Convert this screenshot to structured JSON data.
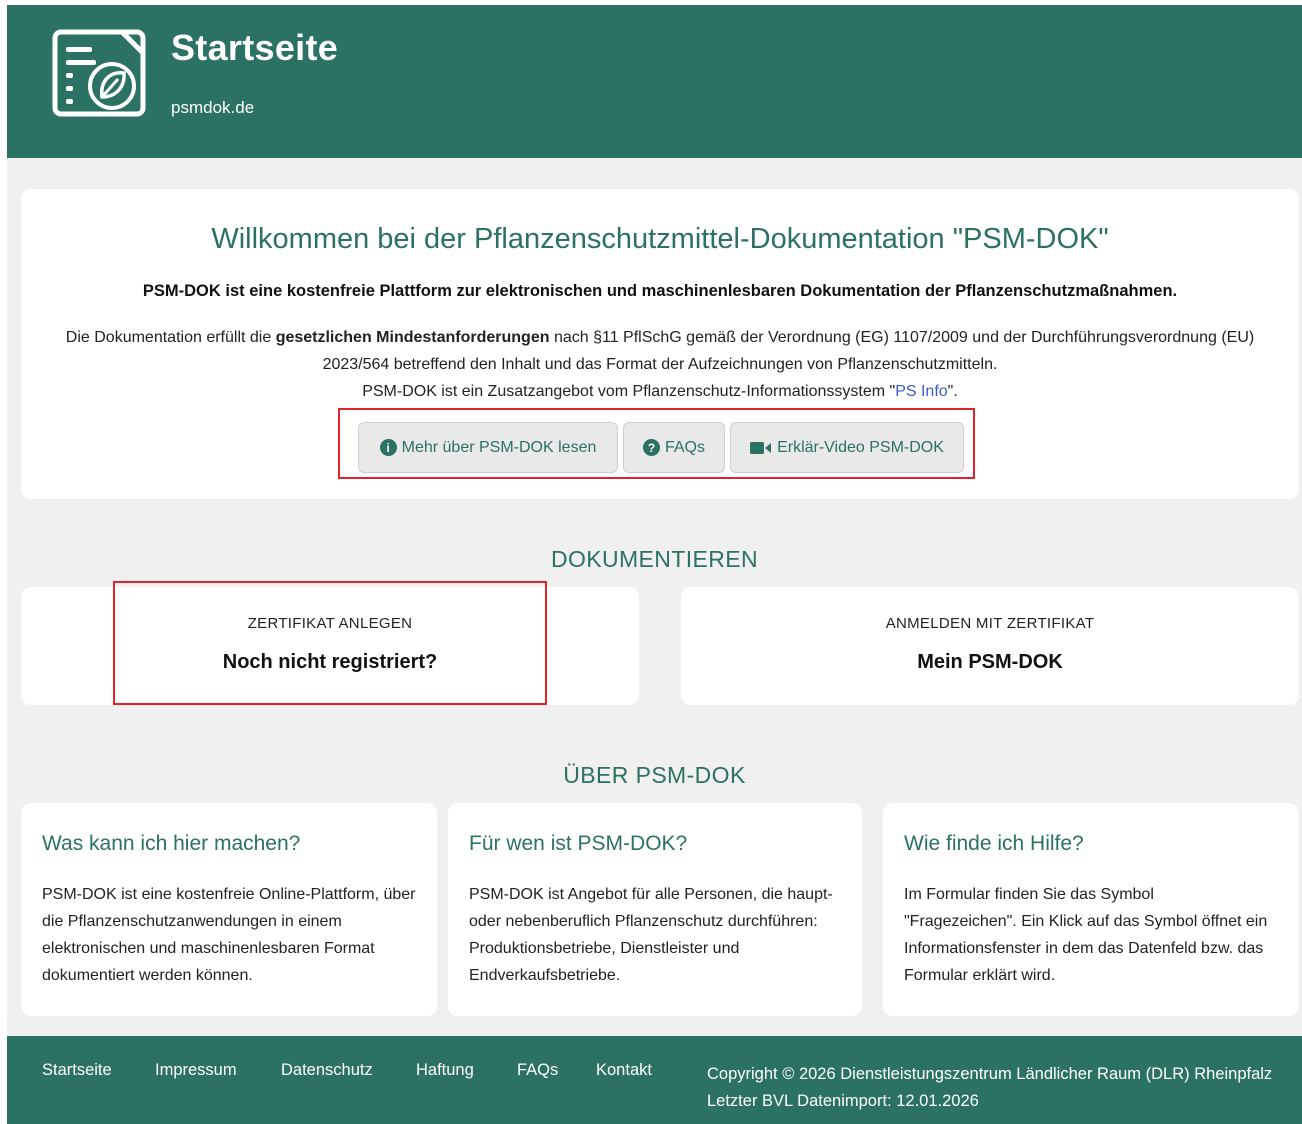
{
  "header": {
    "title": "Startseite",
    "subtitle": "psmdok.de",
    "logo_icon": "document-leaf-icon",
    "bg_color": "#2b7164"
  },
  "welcome": {
    "heading": "Willkommen bei der Pflanzenschutzmittel-Dokumentation \"PSM-DOK\"",
    "lead": "PSM-DOK ist eine kostenfreie Plattform zur elektronischen und maschinenlesbaren Dokumentation der Pflanzenschutzmaßnahmen.",
    "desc_part1": "Die Dokumentation erfüllt die ",
    "desc_bold": "gesetzlichen Mindestanforderungen",
    "desc_part2": " nach §11 PflSchG gemäß der Verordnung (EG) 1107/2009 und der Durchführungsverordnung (EU) 2023/564 betreffend den Inhalt und das Format der Aufzeichnungen von Pflanzenschutzmitteln.",
    "desc_line3_pre": "PSM-DOK ist ein Zusatzangebot vom Pflanzenschutz-Informationssystem \"",
    "desc_link": "PS Info",
    "desc_line3_post": "\".",
    "buttons": {
      "more_label": "Mehr über PSM-DOK lesen",
      "more_icon": "info-circle-icon",
      "faq_label": "FAQs",
      "faq_icon": "question-circle-icon",
      "video_label": "Erklär-Video PSM-DOK",
      "video_icon": "video-camera-icon"
    }
  },
  "dokumentieren": {
    "title": "DOKUMENTIEREN",
    "register": {
      "small": "ZERTIFIKAT ANLEGEN",
      "big": "Noch nicht registriert?"
    },
    "login": {
      "small": "ANMELDEN MIT ZERTIFIKAT",
      "big": "Mein PSM-DOK"
    }
  },
  "about": {
    "title": "ÜBER PSM-DOK",
    "cards": [
      {
        "title": "Was kann ich hier machen?",
        "text": "PSM-DOK ist eine kostenfreie Online-Plattform, über die Pflanzenschutzanwendungen in einem elektronischen und maschinenlesbaren Format dokumentiert werden können."
      },
      {
        "title": "Für wen ist PSM-DOK?",
        "text": "PSM-DOK ist Angebot für alle Personen, die haupt- oder nebenberuflich Pflanzenschutz durchführen: Produktionsbetriebe, Dienstleister und Endverkaufsbetriebe."
      },
      {
        "title": "Wie finde ich Hilfe?",
        "text": "Im Formular finden Sie das Symbol \"Fragezeichen\". Ein Klick auf das Symbol öffnet ein Informationsfenster in dem das Datenfeld bzw. das Formular erklärt wird."
      }
    ]
  },
  "footer": {
    "links": [
      "Startseite",
      "Impressum",
      "Datenschutz",
      "Haftung",
      "FAQs",
      "Kontakt"
    ],
    "copyright": "Copyright © 2026 Dienstleistungszentrum Ländlicher Raum (DLR) Rheinpfalz",
    "import": "Letzter BVL Datenimport: 12.01.2026"
  }
}
